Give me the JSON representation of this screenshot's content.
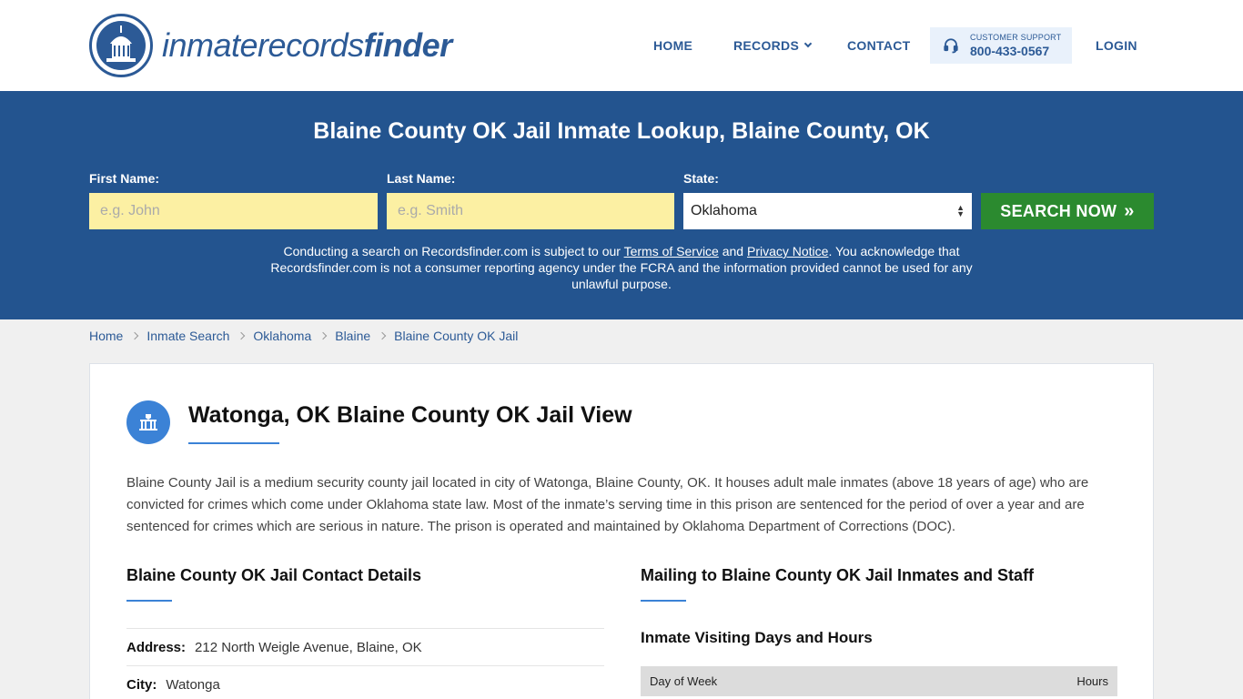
{
  "header": {
    "logo": {
      "part1": "inmaterecords",
      "part2": "finder"
    },
    "nav": {
      "home": "HOME",
      "records": "RECORDS",
      "contact": "CONTACT",
      "login": "LOGIN"
    },
    "support": {
      "label": "CUSTOMER SUPPORT",
      "phone": "800-433-0567"
    }
  },
  "hero": {
    "title": "Blaine County OK Jail Inmate Lookup, Blaine County, OK",
    "first_name": {
      "label": "First Name:",
      "placeholder": "e.g. John"
    },
    "last_name": {
      "label": "Last Name:",
      "placeholder": "e.g. Smith"
    },
    "state": {
      "label": "State:",
      "selected": "Oklahoma"
    },
    "search_button": "SEARCH NOW",
    "disclaimer": {
      "pre": "Conducting a search on Recordsfinder.com is subject to our ",
      "tos": "Terms of Service",
      "and": " and ",
      "privacy": "Privacy Notice",
      "post": ". You acknowledge that Recordsfinder.com is not a consumer reporting agency under the FCRA and the information provided cannot be used for any unlawful purpose."
    }
  },
  "breadcrumb": [
    "Home",
    "Inmate Search",
    "Oklahoma",
    "Blaine",
    "Blaine County OK Jail"
  ],
  "main": {
    "title": "Watonga, OK Blaine County OK Jail View",
    "intro": "Blaine County Jail is a medium security county jail located in city of Watonga, Blaine County, OK. It houses adult male inmates (above 18 years of age) who are convicted for crimes which come under Oklahoma state law. Most of the inmate’s serving time in this prison are sentenced for the period of over a year and are sentenced for crimes which are serious in nature. The prison is operated and maintained by Oklahoma Department of Corrections (DOC).",
    "contact": {
      "title": "Blaine County OK Jail Contact Details",
      "address_label": "Address:",
      "address_value": "212 North Weigle Avenue, Blaine, OK",
      "city_label": "City:",
      "city_value": "Watonga"
    },
    "mailing": {
      "title": "Mailing to Blaine County OK Jail Inmates and Staff",
      "visiting_title": "Inmate Visiting Days and Hours",
      "table_headers": [
        "Day of Week",
        "Hours"
      ]
    }
  }
}
